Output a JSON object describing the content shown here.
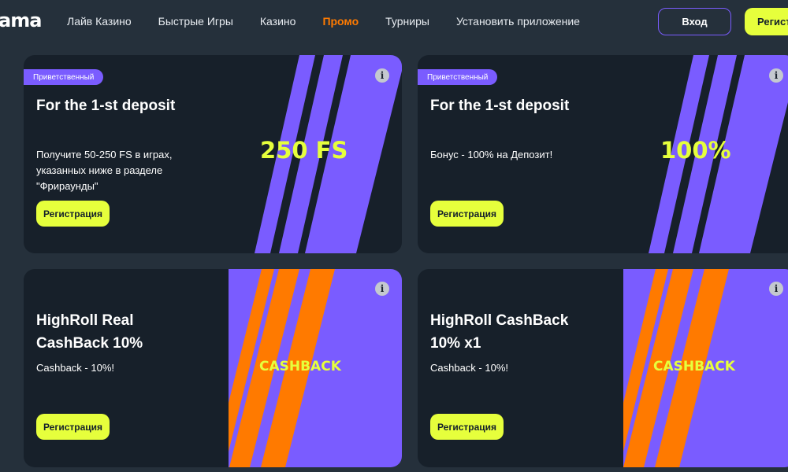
{
  "header": {
    "logo": "ama",
    "nav": [
      {
        "label": "Лайв Казино",
        "active": false
      },
      {
        "label": "Быстрые Игры",
        "active": false
      },
      {
        "label": "Казино",
        "active": false
      },
      {
        "label": "Промо",
        "active": true
      },
      {
        "label": "Турниры",
        "active": false
      },
      {
        "label": "Установить приложение",
        "active": false
      }
    ],
    "login_label": "Вход",
    "register_label": "Регистрация"
  },
  "colors": {
    "accent_lime": "#e6ff3c",
    "accent_purple": "#7a5cff",
    "accent_orange": "#ff7a00",
    "background": "#25303b",
    "card_background": "#17202a"
  },
  "cards": [
    {
      "badge": "Приветственный",
      "title_lines": [
        "For the 1-st deposit"
      ],
      "description_lines": [
        "Получите 50-250 FS в играх,",
        "указанных ниже в разделе",
        "\"Фрираунды\""
      ],
      "big_label": "250 FS",
      "button_label": "Регистрация",
      "info_icon": "info-icon"
    },
    {
      "badge": "Приветственный",
      "title_lines": [
        "For the 1-st deposit"
      ],
      "description_lines": [
        "Бонус - 100% на Депозит!"
      ],
      "big_label": "100%",
      "button_label": "Регистрация",
      "info_icon": "info-icon"
    },
    {
      "title_lines": [
        "HighRoll Real",
        "CashBack 10%"
      ],
      "description_lines": [
        "Cashback - 10%!"
      ],
      "big_label": "CASHBACK",
      "button_label": "Регистрация",
      "info_icon": "info-icon"
    },
    {
      "title_lines": [
        "HighRoll CashBack",
        "10% x1"
      ],
      "description_lines": [
        "Cashback - 10%!"
      ],
      "big_label": "CASHBACK",
      "button_label": "Регистрация",
      "info_icon": "info-icon"
    }
  ]
}
